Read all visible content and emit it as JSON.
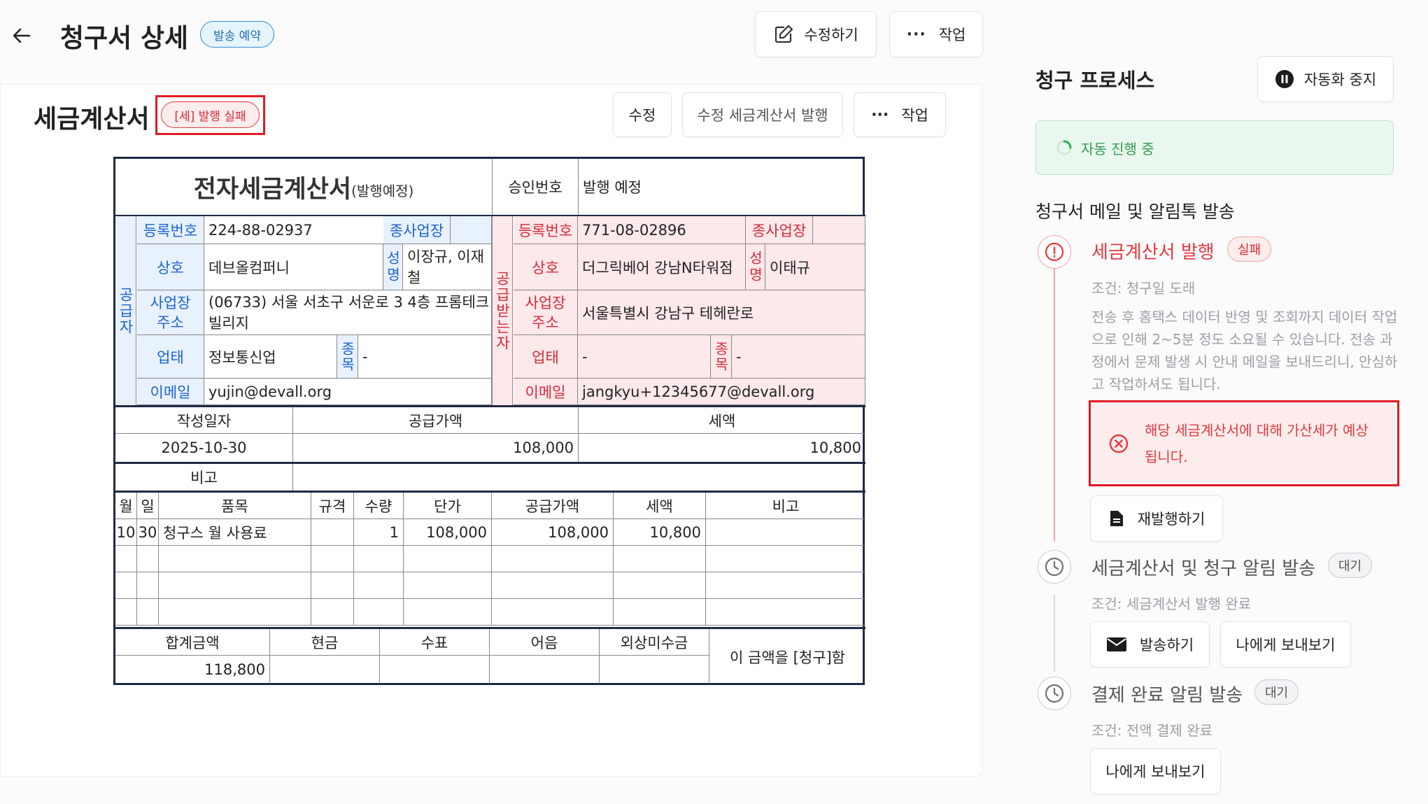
{
  "header": {
    "title": "청구서 상세",
    "status_badge": "발송 예약",
    "edit_label": "수정하기",
    "action_label": "작업"
  },
  "tax_section": {
    "title": "세금계산서",
    "status_badge": "[세] 발행 실패",
    "edit_label": "수정",
    "amend_label": "수정 세금계산서 발행",
    "action_label": "작업"
  },
  "invoice": {
    "title": "전자세금계산서",
    "title_suffix": "(발행예정)",
    "approval_label": "승인번호",
    "approval_value": "발행 예정",
    "supplier": {
      "side_label": "공급자",
      "reg_label": "등록번호",
      "reg_value": "224-88-02937",
      "branch_label": "종사업장",
      "name_label": "상호",
      "name_value": "데브올컴퍼니",
      "rep_label": "성명",
      "rep_value": "이장규, 이재철",
      "addr_label_1": "사업장",
      "addr_label_2": "주소",
      "addr_value": "(06733) 서울 서초구 서운로 3 4층 프롬테크빌리지",
      "type_label": "업태",
      "type_value": "정보통신업",
      "item_label": "종목",
      "item_value": "-",
      "email_label": "이메일",
      "email_value": "yujin@devall.org"
    },
    "receiver": {
      "side_label": "공급받는자",
      "reg_label": "등록번호",
      "reg_value": "771-08-02896",
      "branch_label": "종사업장",
      "name_label": "상호",
      "name_value": "더그릭베어 강남N타워점",
      "rep_label": "성명",
      "rep_value": "이태규",
      "addr_label_1": "사업장",
      "addr_label_2": "주소",
      "addr_value": "서울특별시 강남구 테헤란로",
      "type_label": "업태",
      "type_value": "-",
      "item_label": "종목",
      "item_value": "-",
      "email_label": "이메일",
      "email_value": "jangkyu+12345677@devall.org"
    },
    "summary": {
      "date_label": "작성일자",
      "supply_label": "공급가액",
      "tax_label": "세액",
      "date_value": "2025-10-30",
      "supply_value": "108,000",
      "tax_value": "10,800",
      "note_label": "비고"
    },
    "items_header": [
      "월",
      "일",
      "품목",
      "규격",
      "수량",
      "단가",
      "공급가액",
      "세액",
      "비고"
    ],
    "items": [
      [
        "10",
        "30",
        "청구스 월 사용료",
        "",
        "1",
        "108,000",
        "108,000",
        "10,800",
        ""
      ]
    ],
    "totals": {
      "total_label": "합계금액",
      "cash_label": "현금",
      "check_label": "수표",
      "note_label": "어음",
      "credit_label": "외상미수금",
      "total_value": "118,800",
      "claim_text": "이 금액을 [청구]함"
    }
  },
  "sidebar": {
    "title": "청구 프로세스",
    "pause_label": "자동화 중지",
    "auto_status": "자동 진행 중",
    "section_title": "청구서 메일 및 알림톡 발송",
    "steps": [
      {
        "title": "세금계산서 발행",
        "badge": "실패",
        "condition": "조건: 청구일 도래",
        "desc": "전송 후 홈택스 데이터 반영 및 조회까지 데이터 작업으로 인해 2~5분 정도 소요될 수 있습니다. 전송 과정에서 문제 발생 시 안내 메일을 보내드리니, 안심하고 작업하셔도 됩니다.",
        "error": "해당 세금계산서에 대해 가산세가 예상됩니다.",
        "button": "재발행하기"
      },
      {
        "title": "세금계산서 및 청구 알림 발송",
        "badge": "대기",
        "condition": "조건: 세금계산서 발행 완료",
        "button": "발송하기",
        "button2": "나에게 보내보기"
      },
      {
        "title": "결제 완료 알림 발송",
        "badge": "대기",
        "condition": "조건: 전액 결제 완료",
        "button": "나에게 보내보기"
      }
    ]
  },
  "colors": {
    "accent_red": "#e5393f",
    "supplier_blue": "#1a62d6",
    "receiver_red": "#d62a3a",
    "success_green": "#2eae5b"
  }
}
